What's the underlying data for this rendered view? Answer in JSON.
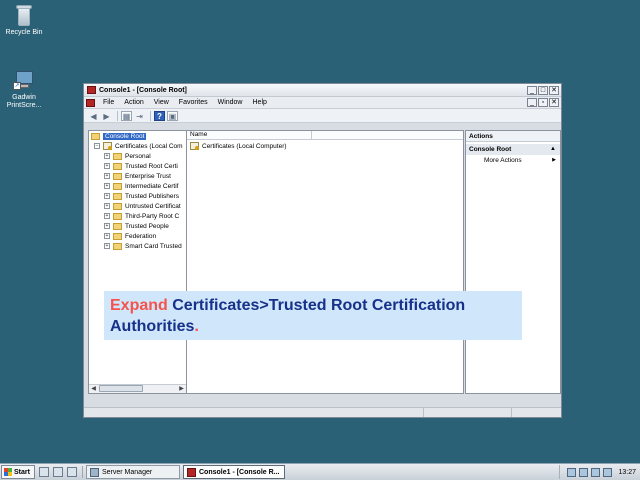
{
  "desktop": {
    "icons": [
      {
        "label": "Recycle Bin",
        "icon": "recycle-bin-icon"
      },
      {
        "label": "Gadwin PrintScre...",
        "icon": "gadwin-printscreen-icon"
      }
    ]
  },
  "window": {
    "title": "Console1 - [Console Root]",
    "controls": {
      "minimize": "_",
      "maximize": "□",
      "close": "✕"
    },
    "inner_controls": {
      "minimize": "_",
      "restore": "▫",
      "close": "✕"
    },
    "menu": [
      "File",
      "Action",
      "View",
      "Favorites",
      "Window",
      "Help"
    ],
    "toolbar": {
      "back": "◀",
      "forward": "▶",
      "up": "▦",
      "export": "⇥",
      "help": "?",
      "properties": "▣"
    }
  },
  "tree": {
    "root": "Console Root",
    "certificates_node": "Certificates (Local Com",
    "children": [
      "Personal",
      "Trusted Root Certi",
      "Enterprise Trust",
      "Intermediate Certif",
      "Trusted Publishers",
      "Untrusted Certificat",
      "Third-Party Root C",
      "Trusted People",
      "Federation",
      "Smart Card Trusted"
    ],
    "expander_open": "−",
    "expander_closed": "+"
  },
  "list": {
    "column_name": "Name",
    "rows": [
      "Certificates (Local Computer)"
    ]
  },
  "actions": {
    "header": "Actions",
    "section": "Console Root",
    "section_arrow": "▲",
    "items": [
      {
        "label": "More Actions",
        "arrow": "▶"
      }
    ]
  },
  "callout": {
    "verb": "Expand",
    "text": "Certificates>Trusted Root Certification Authorities",
    "period": "."
  },
  "taskbar": {
    "start": "Start",
    "buttons": [
      {
        "label": "Server Manager",
        "active": false
      },
      {
        "label": "Console1 - [Console R...",
        "active": true
      }
    ],
    "clock": "13:27"
  },
  "colors": {
    "desktop": "#2b6177",
    "callout_bg": "#cfe6fb",
    "callout_text": "#17318a",
    "callout_accent": "#f4544c",
    "selection": "#3169c6"
  }
}
